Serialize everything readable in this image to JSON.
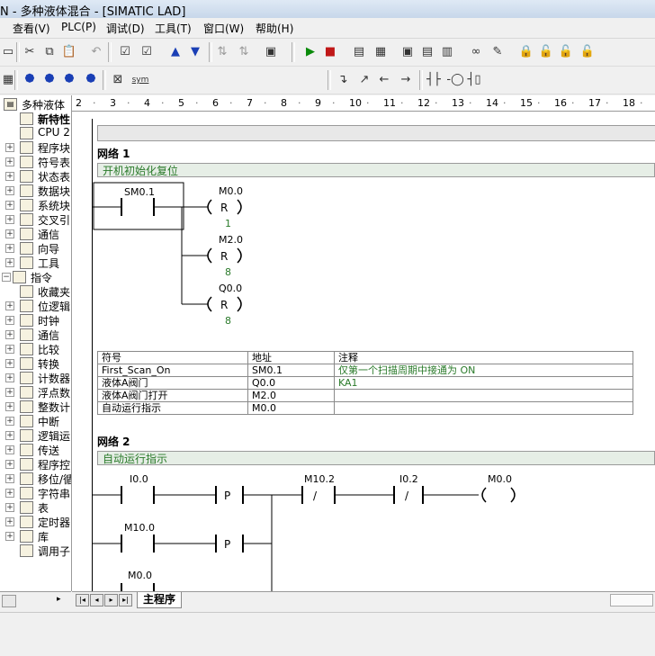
{
  "window": {
    "title": "N - 多种液体混合 - [SIMATIC LAD]"
  },
  "menu": [
    "查看(V)",
    "PLC(P)",
    "调试(D)",
    "工具(T)",
    "窗口(W)",
    "帮助(H)"
  ],
  "toolbar2": {
    "sym": "sym"
  },
  "tree": {
    "root": "多种液体",
    "items": [
      "新特性",
      "CPU 2",
      "程序块",
      "符号表",
      "状态表",
      "数据块",
      "系统块",
      "交叉引",
      "通信",
      "向导",
      "工具",
      "指令",
      "收藏夹",
      "位逻辑",
      "时钟",
      "通信",
      "比较",
      "转换",
      "计数器",
      "浮点数",
      "整数计",
      "中断",
      "逻辑运",
      "传送",
      "程序控",
      "移位/循",
      "字符串",
      "表",
      "定时器",
      "库",
      "调用子"
    ]
  },
  "ruler": [
    "2",
    "3",
    "4",
    "5",
    "6",
    "7",
    "8",
    "9",
    "10",
    "11",
    "12",
    "13",
    "14",
    "15",
    "16",
    "17",
    "18"
  ],
  "networks": [
    {
      "title": "网络 1",
      "comment": "开机初始化复位",
      "contact": "SM0.1",
      "coils": [
        {
          "addr": "M0.0",
          "type": "R",
          "n": "1"
        },
        {
          "addr": "M2.0",
          "type": "R",
          "n": "8"
        },
        {
          "addr": "Q0.0",
          "type": "R",
          "n": "8"
        }
      ],
      "symbol_table": {
        "headers": [
          "符号",
          "地址",
          "注释"
        ],
        "rows": [
          [
            "First_Scan_On",
            "SM0.1",
            "仅第一个扫描周期中接通为 ON"
          ],
          [
            "液体A阀门",
            "Q0.0",
            "KA1"
          ],
          [
            "液体A阀门打开",
            "M2.0",
            ""
          ],
          [
            "自动运行指示",
            "M0.0",
            ""
          ]
        ]
      }
    },
    {
      "title": "网络 2",
      "comment": "自动运行指示",
      "row1": {
        "c1": "I0.0",
        "p": "P",
        "c2": "M10.2",
        "c2type": "/",
        "c3": "I0.2",
        "c3type": "/",
        "coil": "M0.0"
      },
      "row2": {
        "c1": "M10.0",
        "p": "P"
      },
      "row3": {
        "c1": "M0.0"
      }
    }
  ],
  "tabs": {
    "main": "主程序"
  }
}
